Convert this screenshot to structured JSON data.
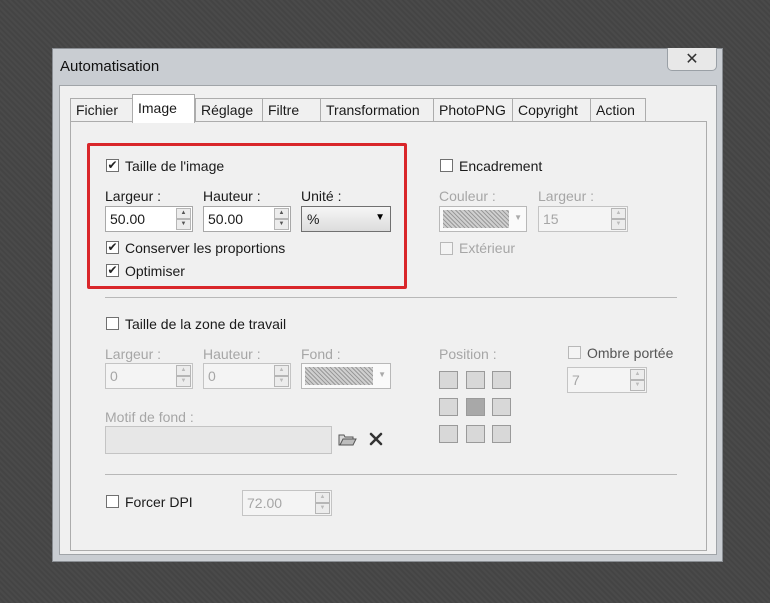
{
  "window": {
    "title": "Automatisation",
    "close_label": "✕"
  },
  "tabs": [
    {
      "label": "Fichier"
    },
    {
      "label": "Image",
      "active": true
    },
    {
      "label": "Réglage"
    },
    {
      "label": "Filtre"
    },
    {
      "label": "Transformation"
    },
    {
      "label": "PhotoPNG"
    },
    {
      "label": "Copyright"
    },
    {
      "label": "Action"
    }
  ],
  "image_size": {
    "checkbox_label": "Taille de l'image",
    "checked": true,
    "width_label": "Largeur :",
    "width_value": "50.00",
    "height_label": "Hauteur :",
    "height_value": "50.00",
    "unit_label": "Unité :",
    "unit_value": "%",
    "keep_proportions_label": "Conserver les proportions",
    "keep_proportions_checked": true,
    "optimize_label": "Optimiser",
    "optimize_checked": true
  },
  "frame": {
    "checkbox_label": "Encadrement",
    "checked": false,
    "color_label": "Couleur :",
    "width_label": "Largeur :",
    "width_value": "15",
    "outside_label": "Extérieur",
    "outside_checked": false
  },
  "canvas": {
    "checkbox_label": "Taille de la zone de travail",
    "checked": false,
    "width_label": "Largeur :",
    "width_value": "0",
    "height_label": "Hauteur :",
    "height_value": "0",
    "background_label": "Fond :",
    "position_label": "Position :",
    "shadow_label": "Ombre portée",
    "shadow_checked": false,
    "shadow_value": "7",
    "pattern_label": "Motif de fond :",
    "pattern_value": ""
  },
  "dpi": {
    "checkbox_label": "Forcer DPI",
    "checked": false,
    "value": "72.00"
  },
  "colors": {
    "highlight": "#d9262a",
    "panel": "#f0f0f0",
    "frame": "#c9cdd2"
  },
  "icons": {
    "folder": "folder-open-icon",
    "delete": "delete-x-icon"
  }
}
